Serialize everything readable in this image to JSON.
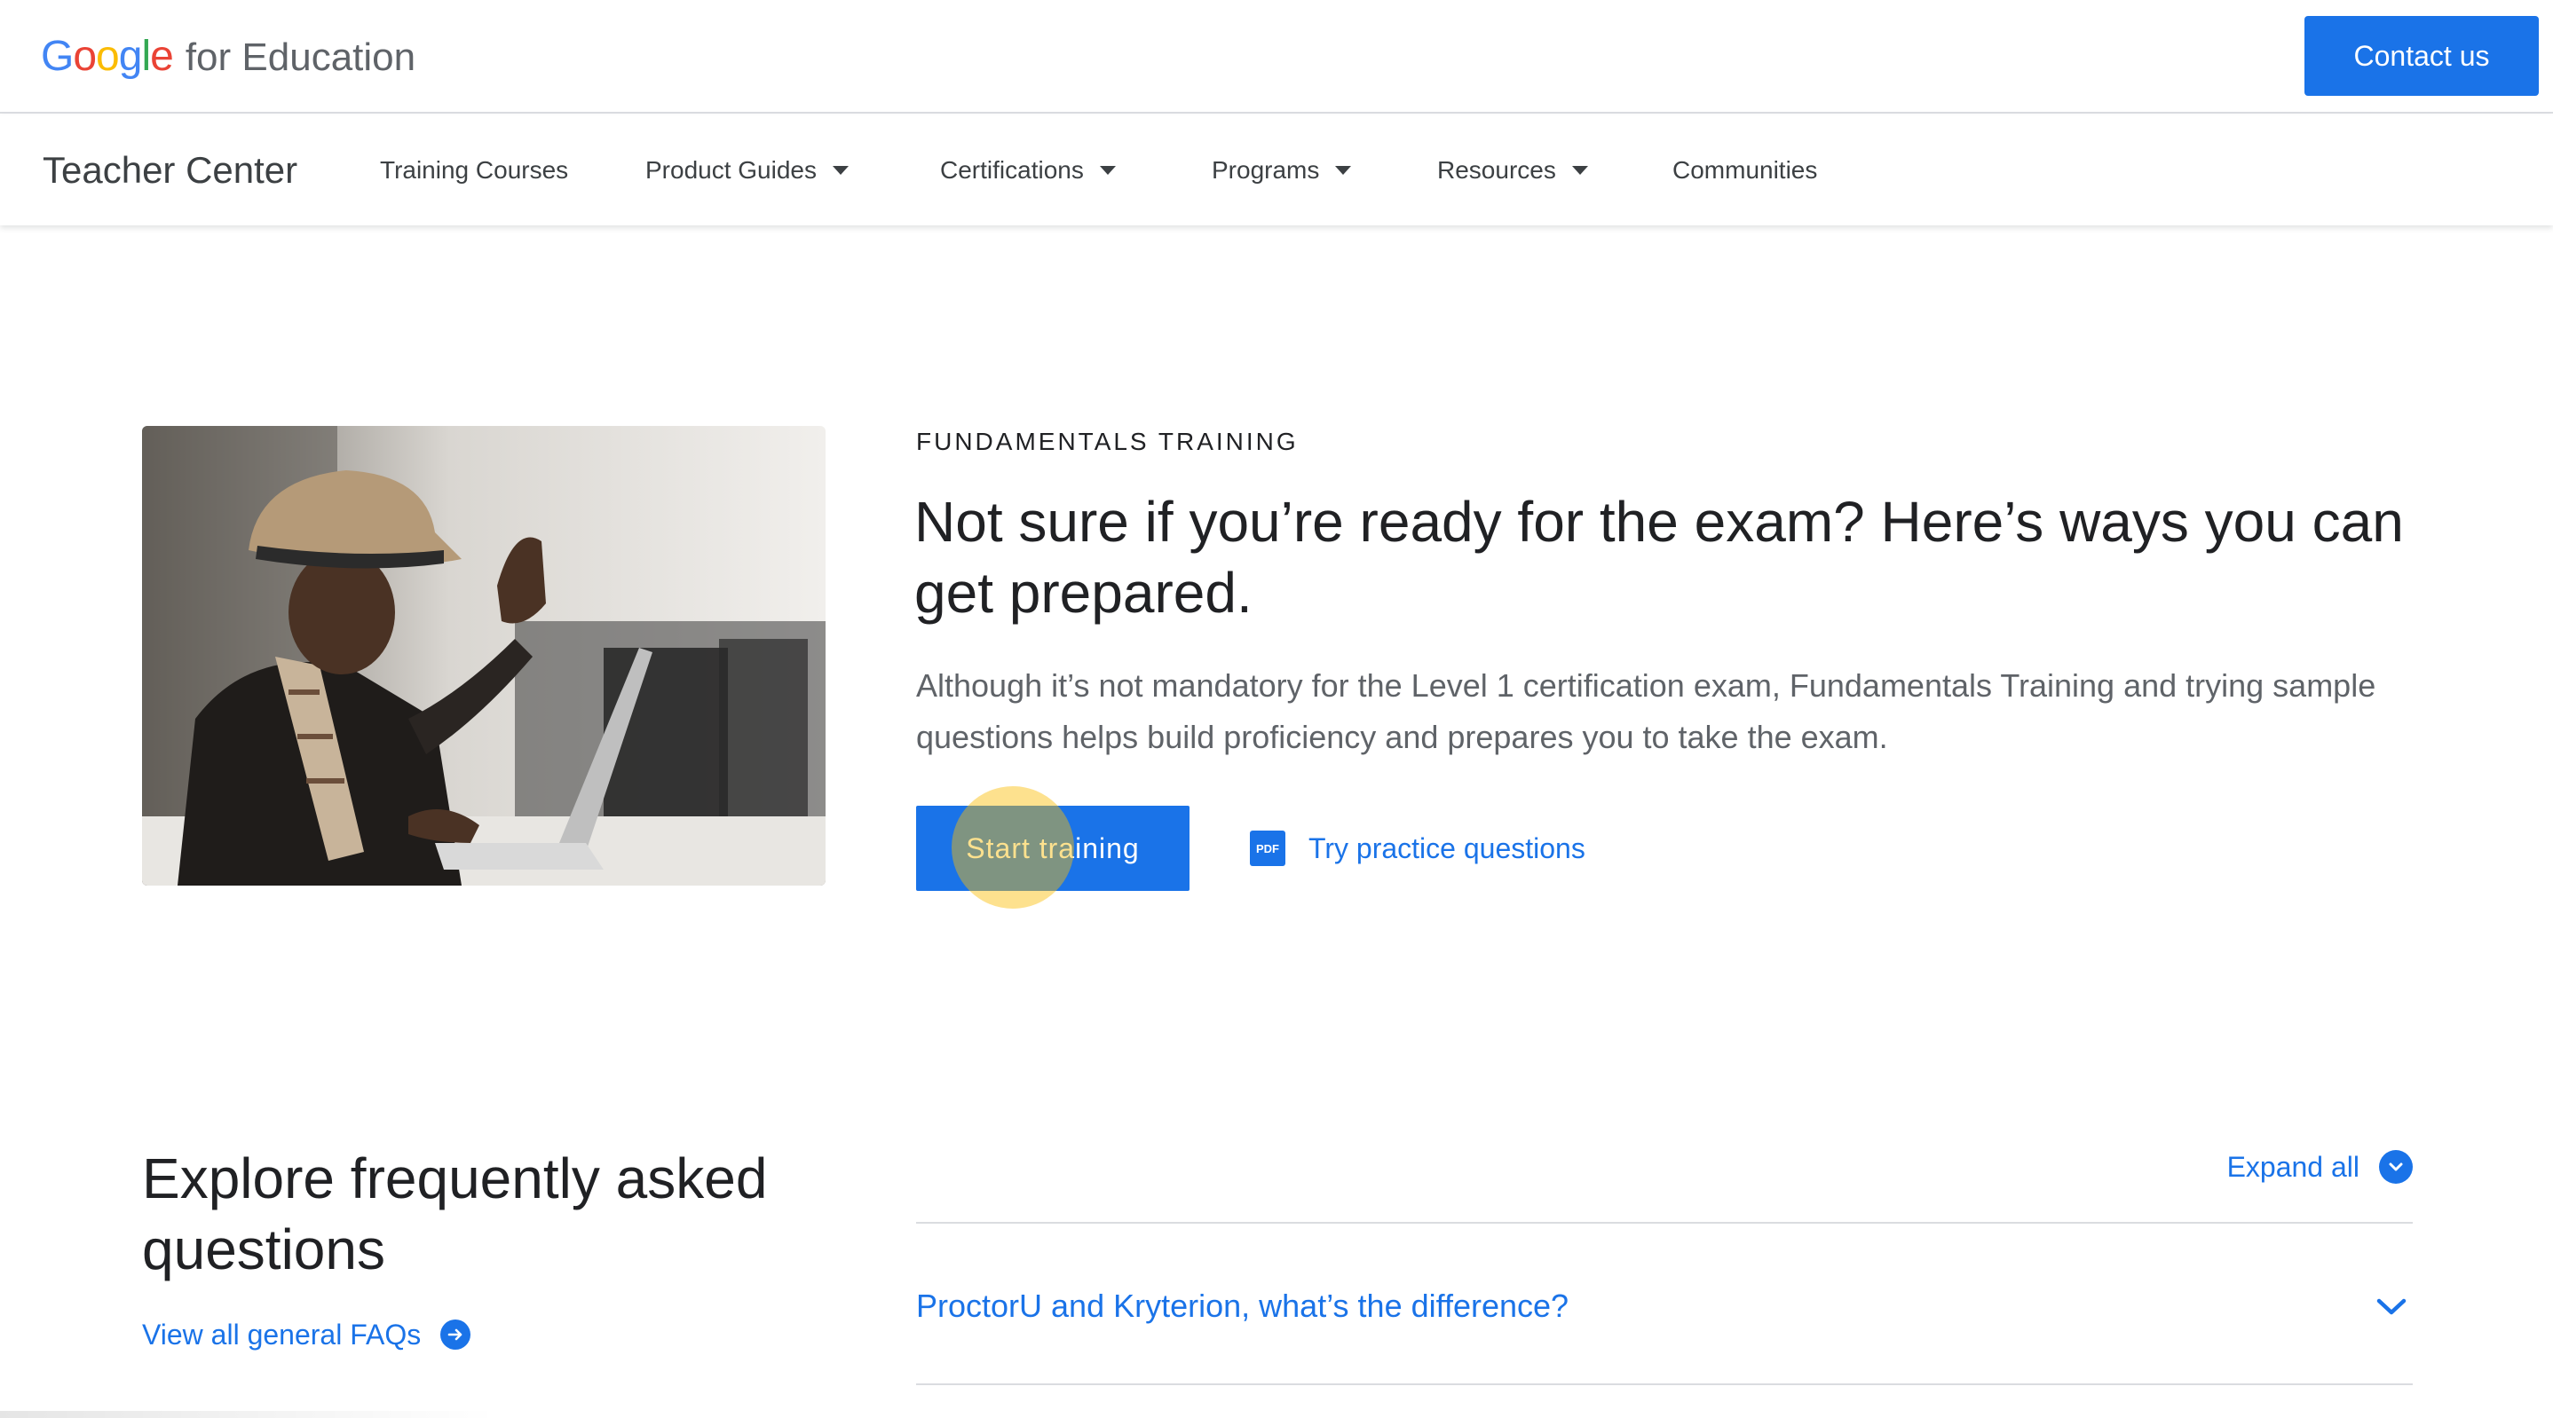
{
  "header": {
    "logo_word": "Google",
    "logo_suffix": "for Education",
    "contact_label": "Contact us"
  },
  "nav": {
    "brand": "Teacher Center",
    "items": [
      {
        "label": "Training Courses",
        "dropdown": false
      },
      {
        "label": "Product Guides",
        "dropdown": true
      },
      {
        "label": "Certifications",
        "dropdown": true
      },
      {
        "label": "Programs",
        "dropdown": true
      },
      {
        "label": "Resources",
        "dropdown": true
      },
      {
        "label": "Communities",
        "dropdown": false
      }
    ]
  },
  "hero": {
    "eyebrow": "FUNDAMENTALS TRAINING",
    "headline": "Not sure if you’re ready for the exam? Here’s ways you can get prepared.",
    "body": "Although it’s not mandatory for the Level 1 certification exam, Fundamentals Training and trying sample questions helps build proficiency and prepares you to take the exam.",
    "primary_button": "Start training",
    "secondary_link": "Try practice questions",
    "pdf_badge": "PDF"
  },
  "faq": {
    "title": "Explore frequently asked questions",
    "view_all": "View all general FAQs",
    "expand_all": "Expand all",
    "questions": [
      "ProctorU and Kryterion, what’s the difference?"
    ]
  },
  "colors": {
    "brand_blue": "#1a73e8",
    "text_primary": "#202124",
    "text_secondary": "#5f6368",
    "divider": "#dadce0",
    "click_highlight": "#fbbc04"
  }
}
